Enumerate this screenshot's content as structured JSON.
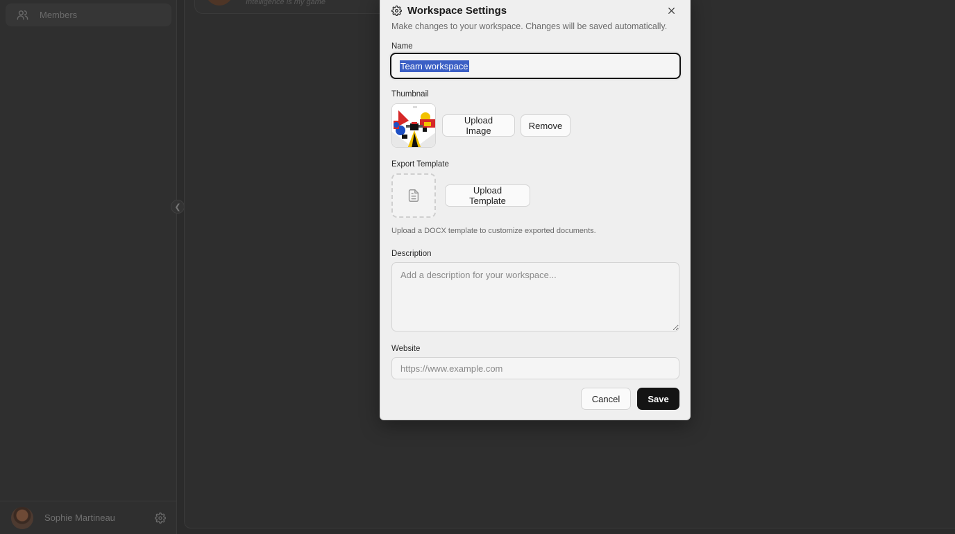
{
  "sidebar": {
    "items": [
      {
        "label": "Members",
        "icon": "users-icon"
      }
    ],
    "user": {
      "name": "Sophie Martineau"
    }
  },
  "background": {
    "card_text": "Intelligence is my game"
  },
  "dialog": {
    "title": "Workspace Settings",
    "description": "Make changes to your workspace. Changes will be saved automatically.",
    "name_label": "Name",
    "name_value": "Team workspace",
    "thumbnail_label": "Thumbnail",
    "upload_image_label": "Upload Image",
    "remove_label": "Remove",
    "export_template_label": "Export Template",
    "upload_template_label": "Upload Template",
    "template_helper": "Upload a DOCX template to customize exported documents.",
    "description_label": "Description",
    "description_placeholder": "Add a description for your workspace...",
    "website_label": "Website",
    "website_placeholder": "https://www.example.com",
    "cancel_label": "Cancel",
    "save_label": "Save"
  },
  "colors": {
    "overlay_bg": "#2b2b2b",
    "dialog_bg": "#efefef",
    "primary_button": "#141414",
    "selection": "#3b5fc5"
  }
}
